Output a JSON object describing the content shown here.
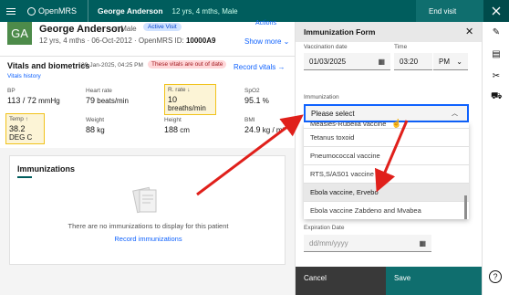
{
  "header": {
    "logo_text": "OpenMRS",
    "patient_name": "George Anderson",
    "patient_meta": "12 yrs, 4 mths, Male",
    "end_visit": "End visit"
  },
  "banner": {
    "initials": "GA",
    "name": "George Anderson",
    "sex": "♂ Male",
    "visit_badge": "Active Visit",
    "meta_prefix": "12 yrs, 4 mths · 06-Oct-2012 · OpenMRS ID:",
    "openmrs_id": "10000A9",
    "actions": "Actions",
    "show_more": "Show more ⌄"
  },
  "vitals": {
    "title": "Vitals and biometrics",
    "date": "29-Jan-2025, 04:25 PM",
    "warning": "These vitals are out of date",
    "record": "Record vitals →",
    "history": "Vitals history",
    "cells": {
      "bp": {
        "label": "BP",
        "value": "113 / 72",
        "unit": "mmHg"
      },
      "hr": {
        "label": "Heart rate",
        "value": "79",
        "unit": "beats/min"
      },
      "rr": {
        "label": "R. rate ↓",
        "value": "10",
        "unit": "breaths/min"
      },
      "spo2": {
        "label": "SpO2",
        "value": "95.1",
        "unit": "%"
      },
      "temp": {
        "label": "Temp ↑",
        "value": "38.2",
        "unit": "DEG C"
      },
      "weight": {
        "label": "Weight",
        "value": "88",
        "unit": "kg"
      },
      "height": {
        "label": "Height",
        "value": "188",
        "unit": "cm"
      },
      "bmi": {
        "label": "BMI",
        "value": "24.9",
        "unit": "kg / m²"
      }
    }
  },
  "immunizations": {
    "title": "Immunizations",
    "empty_text": "There are no immunizations to display for this patient",
    "record_link": "Record immunizations"
  },
  "form": {
    "title": "Immunization Form",
    "vaccination_date_label": "Vaccination date",
    "vaccination_date_value": "01/03/2025",
    "time_label": "Time",
    "time_value": "03:20",
    "ampm_value": "PM",
    "immunization_label": "Immunization",
    "immunization_select": "Please select",
    "options": [
      "Measles-Rubella vaccine",
      "Tetanus toxoid",
      "Pneumococcal vaccine",
      "RTS,S/AS01 vaccine",
      "Ebola vaccine, Ervebo",
      "Ebola vaccine Zabdeno and Mvabea"
    ],
    "expiration_label": "Expiration Date",
    "expiration_placeholder": "dd/mm/yyyy",
    "cancel": "Cancel",
    "save": "Save"
  },
  "colors": {
    "header": "#005d5d",
    "accent": "#0f62fe",
    "arrow": "#e0201b"
  }
}
